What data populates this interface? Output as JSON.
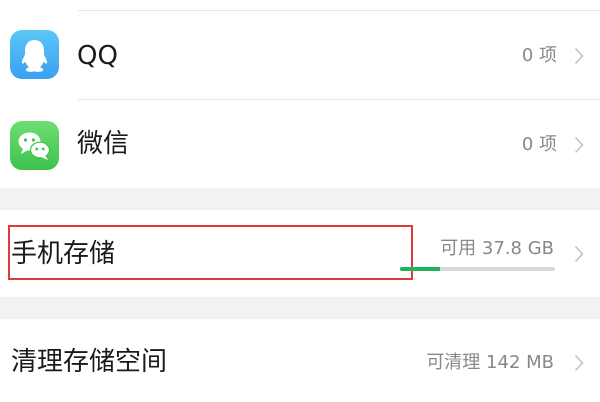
{
  "apps": [
    {
      "name": "QQ",
      "count": "0 项",
      "icon": "qq-penguin-icon",
      "color": "#3aa0f0"
    },
    {
      "name": "微信",
      "count": "0 项",
      "icon": "wechat-bubbles-icon",
      "color": "#3ec24c"
    }
  ],
  "storage": {
    "label": "手机存储",
    "available": "可用 37.8 GB",
    "used_fraction": 0.26,
    "bar_color": "#1fb35a",
    "highlight_color": "#e03a3a"
  },
  "clean": {
    "label": "清理存储空间",
    "value": "可清理 142 MB"
  }
}
